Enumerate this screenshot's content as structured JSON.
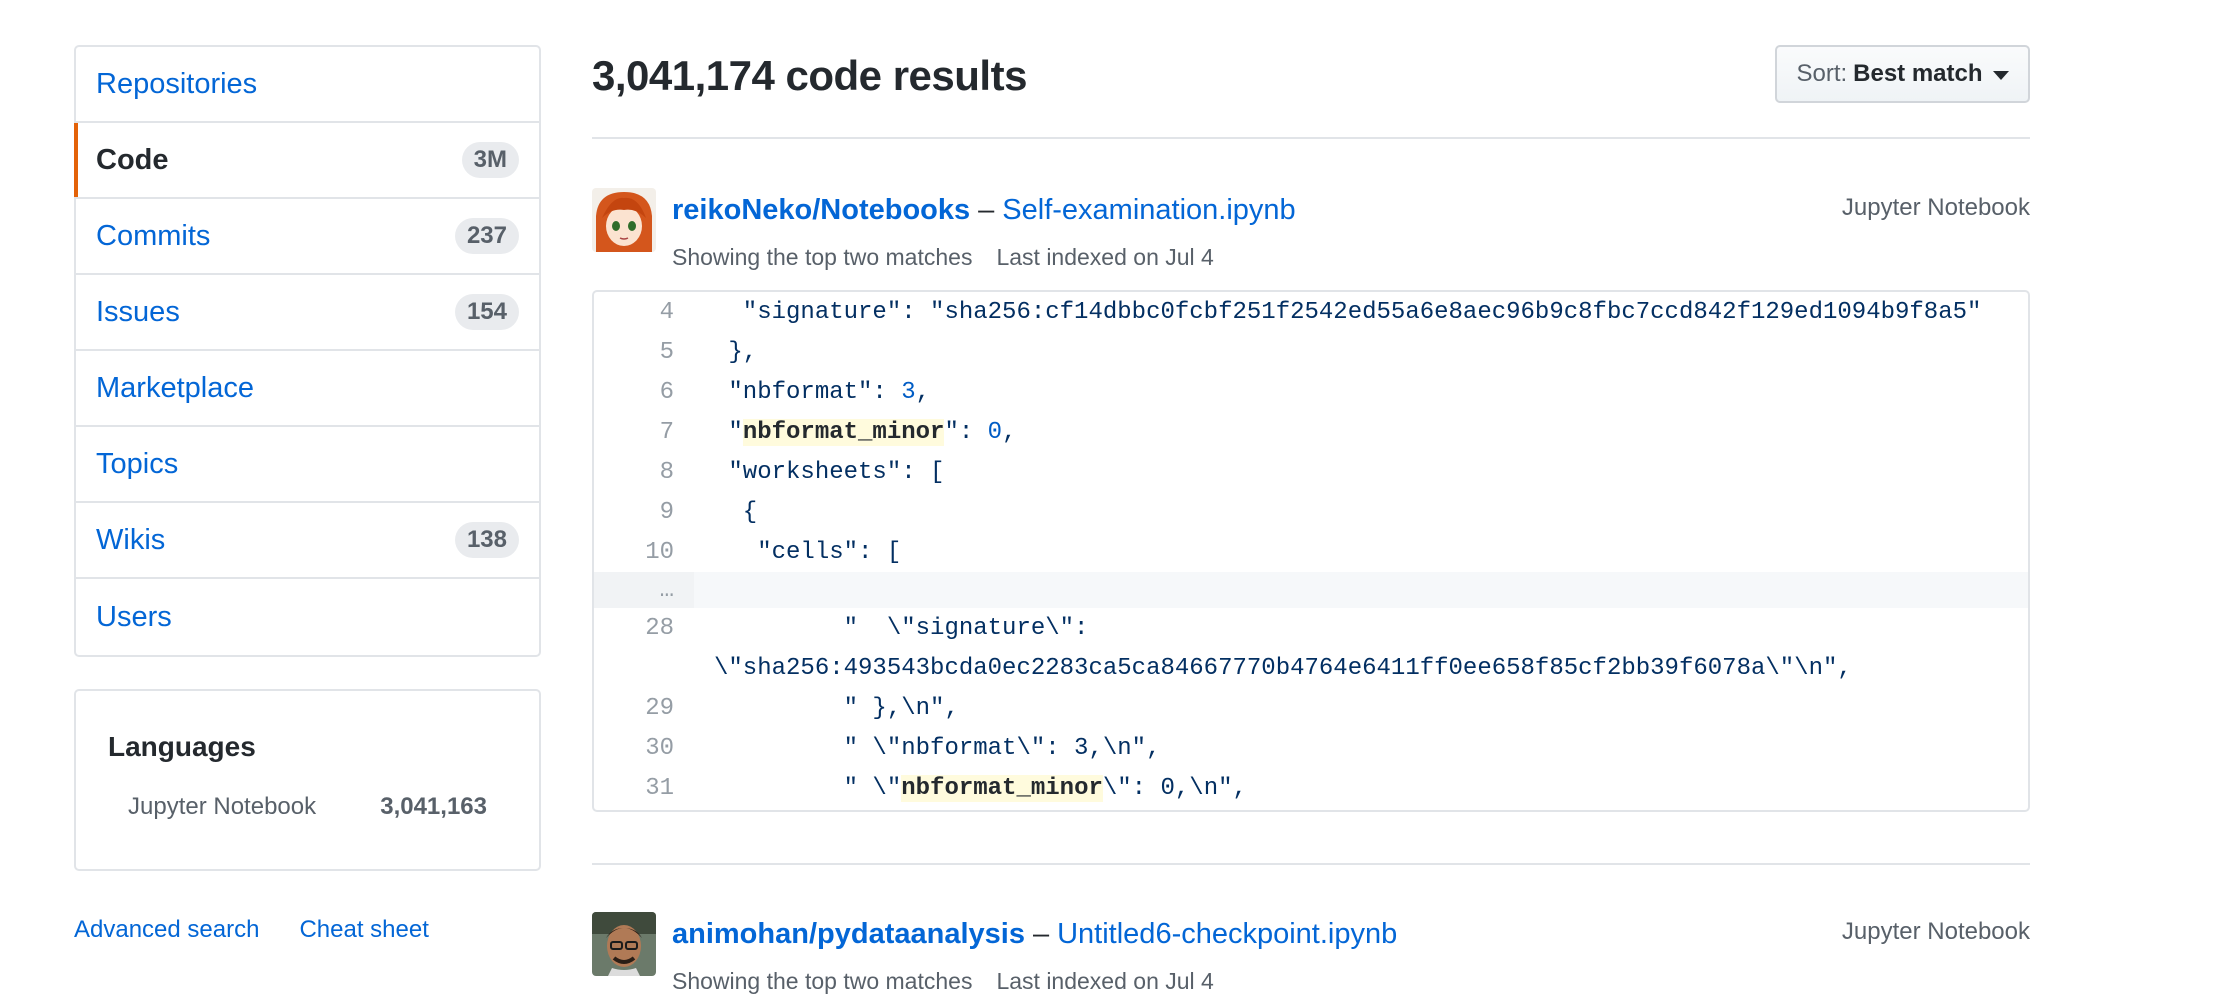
{
  "sidebar": {
    "items": [
      {
        "label": "Repositories",
        "count": ""
      },
      {
        "label": "Code",
        "count": "3M"
      },
      {
        "label": "Commits",
        "count": "237"
      },
      {
        "label": "Issues",
        "count": "154"
      },
      {
        "label": "Marketplace",
        "count": ""
      },
      {
        "label": "Topics",
        "count": ""
      },
      {
        "label": "Wikis",
        "count": "138"
      },
      {
        "label": "Users",
        "count": ""
      }
    ],
    "selected": "Code",
    "accent_color": "#e36209"
  },
  "languages": {
    "title": "Languages",
    "items": [
      {
        "name": "Jupyter Notebook",
        "count": "3,041,163"
      }
    ]
  },
  "footer": {
    "advanced_search": "Advanced search",
    "cheat_sheet": "Cheat sheet"
  },
  "header": {
    "title": "3,041,174 code results",
    "sort_prefix": "Sort:",
    "sort_value": "Best match"
  },
  "results": [
    {
      "repo": "reikoNeko/Notebooks",
      "dash": "–",
      "file": "Self-examination.ipynb",
      "language": "Jupyter Notebook",
      "matches_note": "Showing the top two matches",
      "indexed": "Last indexed on Jul 4",
      "avatar_icon": "anime-avatar",
      "code_lines": [
        {
          "n": "4",
          "text": "  \"signature\": \"sha256:cf14dbbc0fcbf251f2542ed55a6e8aec96b9c8fbc7ccd842f129ed1094b9f8a5\""
        },
        {
          "n": "5",
          "text": " },"
        },
        {
          "n": "6",
          "pre": " \"nbformat\": ",
          "num": "3",
          "post": ","
        },
        {
          "n": "7",
          "pre": " \"",
          "hl": "nbformat_minor",
          "mid": "\": ",
          "num": "0",
          "post": ","
        },
        {
          "n": "8",
          "text": " \"worksheets\": ["
        },
        {
          "n": "9",
          "text": "  {"
        },
        {
          "n": "10",
          "text": "   \"cells\": ["
        },
        {
          "n": "…",
          "text": ""
        },
        {
          "n": "28",
          "text": "         \"  \\\"signature\\\":",
          "wrap": "\\\"sha256:493543bcda0ec2283ca5ca84667770b4764e6411ff0ee658f85cf2bb39f6078a\\\"\\n\","
        },
        {
          "n": "29",
          "text": "         \" },\\n\","
        },
        {
          "n": "30",
          "text": "         \" \\\"nbformat\\\": 3,\\n\","
        },
        {
          "n": "31",
          "pre": "         \" \\\"",
          "hl": "nbformat_minor",
          "mid": "\\\": 0,\\n\",",
          "num": "",
          "post": ""
        }
      ]
    },
    {
      "repo": "animohan/pydataanalysis",
      "dash": "–",
      "file": "Untitled6-checkpoint.ipynb",
      "language": "Jupyter Notebook",
      "matches_note": "Showing the top two matches",
      "indexed": "Last indexed on Jul 4",
      "avatar_icon": "photo-avatar"
    }
  ]
}
